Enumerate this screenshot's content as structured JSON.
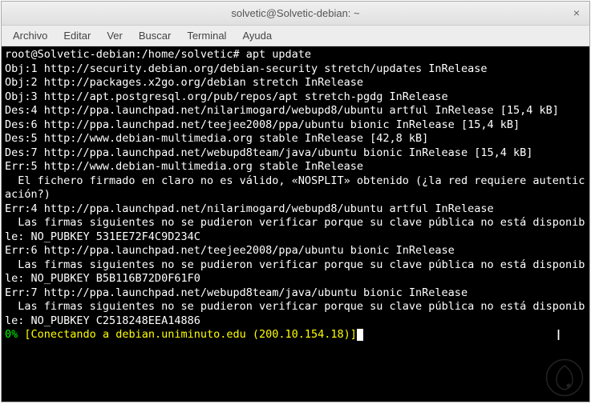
{
  "window": {
    "title": "solvetic@Solvetic-debian: ~"
  },
  "menu": {
    "items": [
      "Archivo",
      "Editar",
      "Ver",
      "Buscar",
      "Terminal",
      "Ayuda"
    ]
  },
  "terminal": {
    "prompt": "root@Solvetic-debian:/home/solvetic# ",
    "command": "apt update",
    "lines": [
      "Obj:1 http://security.debian.org/debian-security stretch/updates InRelease",
      "Obj:2 http://packages.x2go.org/debian stretch InRelease",
      "Obj:3 http://apt.postgresql.org/pub/repos/apt stretch-pgdg InRelease",
      "Des:4 http://ppa.launchpad.net/nilarimogard/webupd8/ubuntu artful InRelease [15,4 kB]",
      "Des:6 http://ppa.launchpad.net/teejee2008/ppa/ubuntu bionic InRelease [15,4 kB]",
      "Des:5 http://www.debian-multimedia.org stable InRelease [42,8 kB]",
      "Des:7 http://ppa.launchpad.net/webupd8team/java/ubuntu bionic InRelease [15,4 kB]",
      "Err:5 http://www.debian-multimedia.org stable InRelease",
      "  El fichero firmado en claro no es válido, «NOSPLIT» obtenido (¿la red requiere autenticación?)",
      "Err:4 http://ppa.launchpad.net/nilarimogard/webupd8/ubuntu artful InRelease",
      "  Las firmas siguientes no se pudieron verificar porque su clave pública no está disponible: NO_PUBKEY 531EE72F4C9D234C",
      "Err:6 http://ppa.launchpad.net/teejee2008/ppa/ubuntu bionic InRelease",
      "  Las firmas siguientes no se pudieron verificar porque su clave pública no está disponible: NO_PUBKEY B5B116B72D0F61F0",
      "Err:7 http://ppa.launchpad.net/webupd8team/java/ubuntu bionic InRelease",
      "  Las firmas siguientes no se pudieron verificar porque su clave pública no está disponible: NO_PUBKEY C2518248EEA14886"
    ],
    "status_percent": "0%",
    "status_text": "[Conectando a debian.uniminuto.edu (200.10.154.18)]"
  }
}
